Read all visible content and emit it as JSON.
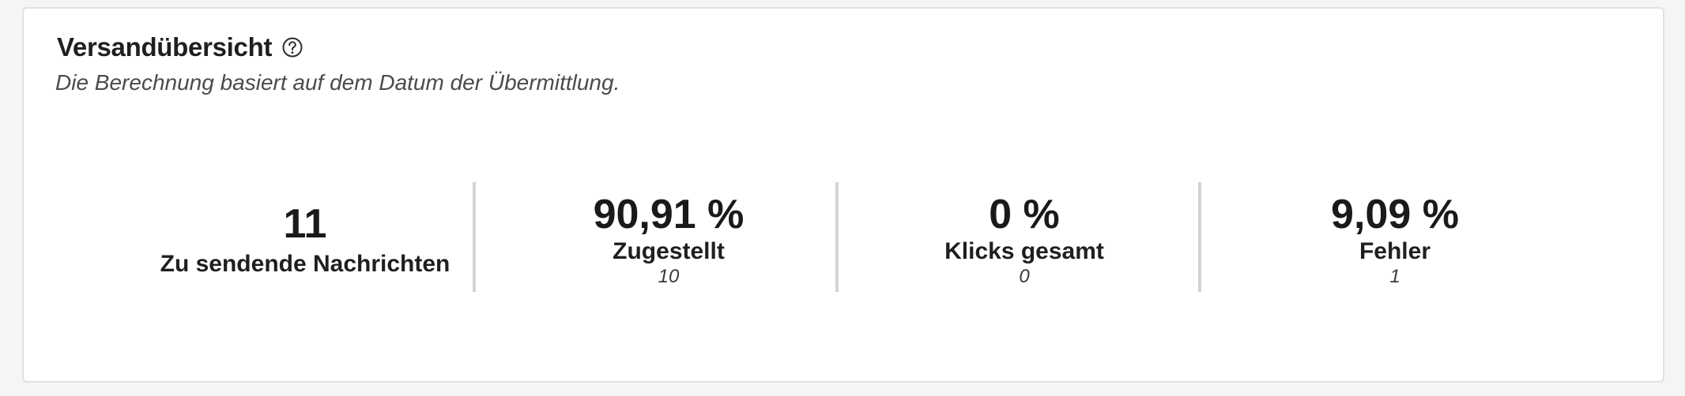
{
  "overview": {
    "title": "Versandübersicht",
    "help_icon": "help-circle-icon",
    "subtitle": "Die Berechnung basiert auf dem Datum der Übermittlung."
  },
  "metrics": [
    {
      "value": "11",
      "label": "Zu sendende Nachrichten"
    },
    {
      "value": "90,91 %",
      "label": "Zugestellt",
      "count": "10"
    },
    {
      "value": "0 %",
      "label": "Klicks gesamt",
      "count": "0"
    },
    {
      "value": "9,09 %",
      "label": "Fehler",
      "count": "1"
    }
  ]
}
